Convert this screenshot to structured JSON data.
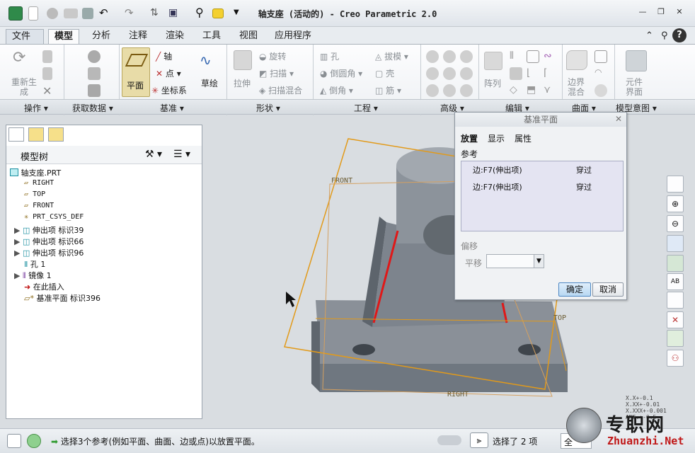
{
  "window": {
    "title": "轴支座 (活动的) - Creo Parametric 2.0"
  },
  "menu_tabs": [
    "文件",
    "模型",
    "分析",
    "注释",
    "渲染",
    "工具",
    "视图",
    "应用程序"
  ],
  "active_tab": "模型",
  "ribbon": {
    "regenerate_label": "重新生成",
    "datum_plane": "平面",
    "datum_axis": "轴",
    "datum_point": "点",
    "datum_csys": "坐标系",
    "sketch": "草绘",
    "extrude": "拉伸",
    "revolve": "旋转",
    "sweep": "扫描",
    "swept_blend": "扫描混合",
    "hole": "孔",
    "round": "倒圆角",
    "chamfer": "倒角",
    "draft": "拔模",
    "shell": "壳",
    "rib": "筋",
    "pattern": "阵列",
    "boundary_blend": "边界混合",
    "component_interface": "元件界面"
  },
  "groups": [
    "操作",
    "获取数据",
    "基准",
    "形状",
    "工程",
    "高级",
    "编辑",
    "曲面",
    "模型意图"
  ],
  "model_tree": {
    "title": "模型树",
    "items": [
      {
        "label": "轴支座.PRT",
        "type": "part"
      },
      {
        "label": "RIGHT",
        "type": "plane"
      },
      {
        "label": "TOP",
        "type": "plane"
      },
      {
        "label": "FRONT",
        "type": "plane"
      },
      {
        "label": "PRT_CSYS_DEF",
        "type": "csys"
      },
      {
        "label": "伸出项 标识39",
        "type": "extrude"
      },
      {
        "label": "伸出项 标识66",
        "type": "extrude"
      },
      {
        "label": "伸出项 标识96",
        "type": "extrude"
      },
      {
        "label": "孔 1",
        "type": "hole"
      },
      {
        "label": "镜像 1",
        "type": "mirror"
      },
      {
        "label": "在此插入",
        "type": "insert"
      },
      {
        "label": "基准平面 标识396",
        "type": "newplane"
      }
    ]
  },
  "viewport": {
    "label_front": "FRONT",
    "label_top": "TOP",
    "label_right": "RIGHT"
  },
  "dialog": {
    "title": "基准平面",
    "tabs": [
      "放置",
      "显示",
      "属性"
    ],
    "references_label": "参考",
    "references": [
      {
        "ref": "边:F7(伸出项)",
        "constraint": "穿过"
      },
      {
        "ref": "边:F7(伸出项)",
        "constraint": "穿过"
      }
    ],
    "offset_label": "偏移",
    "translation_label": "平移",
    "ok": "确定",
    "cancel": "取消"
  },
  "status": {
    "message": "选择3个参考(例如平面、曲面、边或点)以放置平面。",
    "selection": "选择了 2 项",
    "filter": "全"
  },
  "watermark": {
    "name": "专职网",
    "url": "Zhuanzhi.Net"
  },
  "tolerance": {
    "t1": "X.X+-0.1",
    "t2": "X.XX+-0.01",
    "t3": "X.XXX+-0.001",
    "t4": "ANG.+-0.5"
  }
}
